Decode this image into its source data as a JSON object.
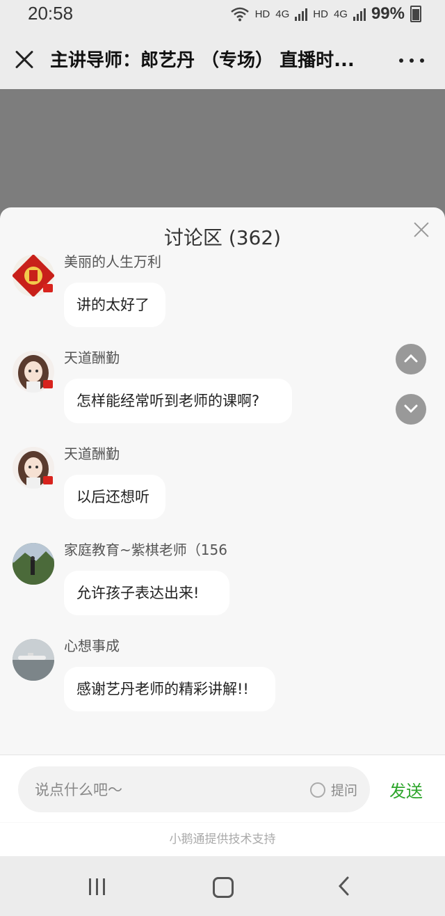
{
  "status": {
    "time": "20:58",
    "hd1": "HD",
    "net1": "4G",
    "hd2": "HD",
    "net2": "4G",
    "battery": "99%"
  },
  "title_bar": {
    "title": "主讲导师：郎艺丹 （专场） 直播时..."
  },
  "discussion": {
    "title": "讨论区 (362)"
  },
  "messages": [
    {
      "name": "美丽的人生万利",
      "text": "讲的太好了"
    },
    {
      "name": "天道酬勤",
      "text": "怎样能经常听到老师的课啊?"
    },
    {
      "name": "天道酬勤",
      "text": "以后还想听"
    },
    {
      "name": "家庭教育~紫棋老师（156",
      "text": "允许孩子表达出来!"
    },
    {
      "name": "心想事成",
      "text": "感谢艺丹老师的精彩讲解!!"
    }
  ],
  "input": {
    "placeholder": "说点什么吧～",
    "question_label": "提问",
    "send_label": "发送"
  },
  "footer": {
    "text": "小鹅通提供技术支持"
  },
  "colors": {
    "accent": "#2ca52a",
    "badge": "#d8231d"
  }
}
